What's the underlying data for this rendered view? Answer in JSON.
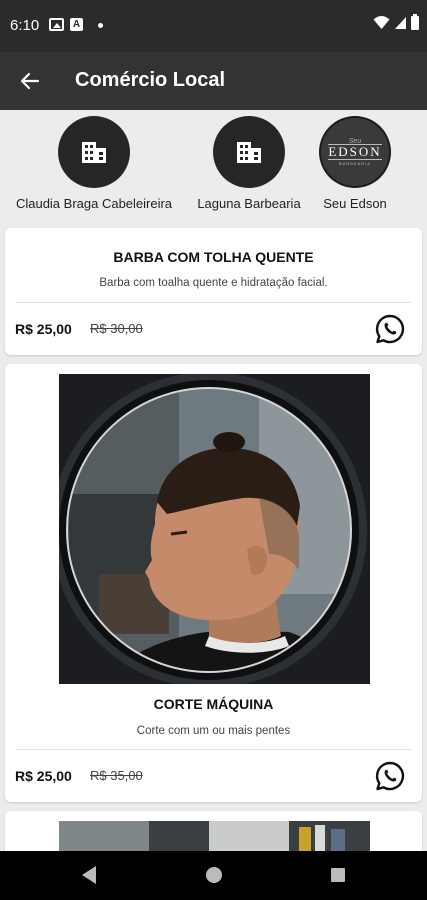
{
  "status_bar": {
    "time": "6:10",
    "icons": [
      "photo-icon",
      "a-icon",
      "dot-icon",
      "wifi-icon",
      "signal-icon",
      "battery-icon"
    ]
  },
  "app_bar": {
    "title": "Comércio Local",
    "back_icon": "arrow-left-icon"
  },
  "stores": [
    {
      "name": "Claudia Braga Cabeleireira",
      "icon": "building-icon"
    },
    {
      "name": "Laguna Barbearia",
      "icon": "building-icon"
    },
    {
      "name": "Seu Edson",
      "logo_small": "Seu",
      "logo_big": "EDSON",
      "logo_tiny": "BARBEARIA"
    }
  ],
  "products": [
    {
      "title": "BARBA COM TOLHA QUENTE",
      "description": "Barba com toalha quente e hidratação facial.",
      "price": "R$ 25,00",
      "old_price": "R$ 30,00",
      "action_icon": "whatsapp-icon"
    },
    {
      "title": "CORTE MÁQUINA",
      "description": "Corte com um ou mais pentes",
      "price": "R$ 25,00",
      "old_price": "R$ 35,00",
      "action_icon": "whatsapp-icon"
    }
  ],
  "colors": {
    "app_bar": "#333333",
    "status_bar": "#2b2b2b",
    "background": "#ececec",
    "card": "#ffffff"
  }
}
